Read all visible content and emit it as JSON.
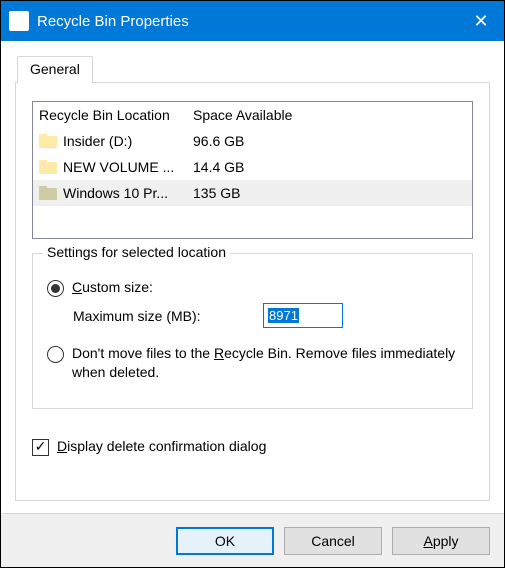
{
  "window": {
    "title": "Recycle Bin Properties"
  },
  "tabs": {
    "general": "General"
  },
  "list": {
    "headers": {
      "location": "Recycle Bin Location",
      "space": "Space Available"
    },
    "rows": [
      {
        "name": "Insider (D:)",
        "space": "96.6 GB",
        "selected": false,
        "dim": false
      },
      {
        "name": "NEW VOLUME ...",
        "space": "14.4 GB",
        "selected": false,
        "dim": false
      },
      {
        "name": "Windows 10 Pr...",
        "space": "135 GB",
        "selected": true,
        "dim": true
      }
    ]
  },
  "settings": {
    "legend": "Settings for selected location",
    "custom_size_label_pre": "C",
    "custom_size_label_post": "ustom size:",
    "max_size_label": "Maximum size (MB):",
    "max_size_value": "8971",
    "dont_move_pre": "Don't move files to the ",
    "dont_move_u": "R",
    "dont_move_post": "ecycle Bin. Remove files immediately when deleted.",
    "custom_checked": true,
    "dont_move_checked": false
  },
  "confirm": {
    "pre": "D",
    "post": "isplay delete confirmation dialog",
    "checked": true
  },
  "buttons": {
    "ok": "OK",
    "cancel": "Cancel",
    "apply_u": "A",
    "apply_post": "pply"
  }
}
